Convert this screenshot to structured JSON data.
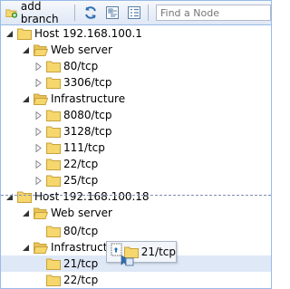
{
  "toolbar": {
    "add_branch_label": "add branch",
    "search_placeholder": "Find a Node"
  },
  "tree": [
    {
      "label": "Host 192.168.100.1",
      "level": 0,
      "expander": "expanded",
      "folder": "closed"
    },
    {
      "label": "Web server",
      "level": 1,
      "expander": "expanded",
      "folder": "open"
    },
    {
      "label": "80/tcp",
      "level": 2,
      "expander": "collapsed",
      "folder": "closed"
    },
    {
      "label": "3306/tcp",
      "level": 2,
      "expander": "collapsed",
      "folder": "closed"
    },
    {
      "label": "Infrastructure",
      "level": 1,
      "expander": "expanded",
      "folder": "open"
    },
    {
      "label": "8080/tcp",
      "level": 2,
      "expander": "collapsed",
      "folder": "closed"
    },
    {
      "label": "3128/tcp",
      "level": 2,
      "expander": "collapsed",
      "folder": "closed"
    },
    {
      "label": "111/tcp",
      "level": 2,
      "expander": "collapsed",
      "folder": "closed"
    },
    {
      "label": "22/tcp",
      "level": 2,
      "expander": "collapsed",
      "folder": "closed"
    },
    {
      "label": "25/tcp",
      "level": 2,
      "expander": "collapsed",
      "folder": "closed"
    },
    {
      "label": "Host 192.168.100.18",
      "level": 0,
      "expander": "expanded",
      "folder": "closed"
    },
    {
      "label": "Web server",
      "level": 1,
      "expander": "expanded",
      "folder": "open"
    },
    {
      "label": "80/tcp",
      "level": 2,
      "expander": "none",
      "folder": "closed"
    },
    {
      "label": "Infrastructure",
      "level": 1,
      "expander": "expanded",
      "folder": "open"
    },
    {
      "label": "21/tcp",
      "level": 2,
      "expander": "none",
      "folder": "closed",
      "selected": true
    },
    {
      "label": "22/tcp",
      "level": 2,
      "expander": "none",
      "folder": "closed"
    }
  ],
  "drag_proxy": {
    "label": "21/tcp"
  },
  "colors": {
    "folder": "#f5d76e",
    "folder_stroke": "#c8a23a",
    "accent": "#99bbe8",
    "selected": "#dfe8f6"
  }
}
